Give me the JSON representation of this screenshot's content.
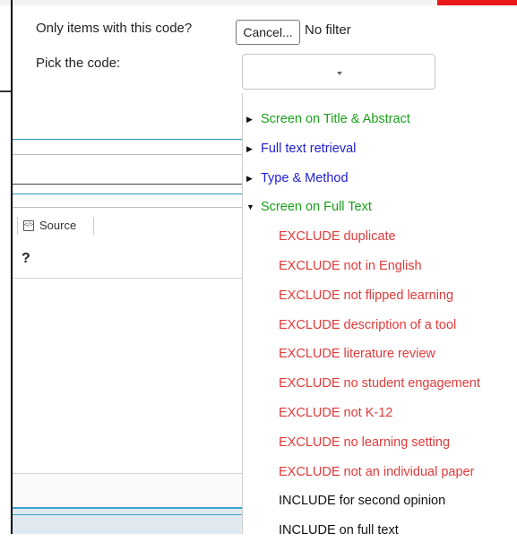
{
  "background": {
    "toolbar": {
      "source_label": "Source"
    },
    "question_mark": "?"
  },
  "popup": {
    "filter_label": "Only items with this code?",
    "cancel_button": "Cancel...",
    "filter_value": "No filter",
    "pick_label": "Pick the code:",
    "select_value": ""
  },
  "tree": [
    {
      "label": "Screen on Title & Abstract",
      "color": "#1aa01a",
      "expanded": false,
      "arrow": "▶"
    },
    {
      "label": "Full text retrieval",
      "color": "#1f1fd6",
      "expanded": false,
      "arrow": "▶"
    },
    {
      "label": "Type & Method",
      "color": "#1f1fd6",
      "expanded": false,
      "arrow": "▶"
    },
    {
      "label": "Screen on Full Text",
      "color": "#1aa01a",
      "expanded": true,
      "arrow": "▼",
      "children": [
        {
          "label": "EXCLUDE duplicate",
          "color": "#e03a3a"
        },
        {
          "label": "EXCLUDE not in English",
          "color": "#e03a3a"
        },
        {
          "label": "EXCLUDE not flipped learning",
          "color": "#e03a3a"
        },
        {
          "label": "EXCLUDE description of a tool",
          "color": "#e03a3a"
        },
        {
          "label": "EXCLUDE literature review",
          "color": "#e03a3a"
        },
        {
          "label": "EXCLUDE no student engagement",
          "color": "#e03a3a"
        },
        {
          "label": "EXCLUDE not K-12",
          "color": "#e03a3a"
        },
        {
          "label": "EXCLUDE no learning setting",
          "color": "#e03a3a"
        },
        {
          "label": "EXCLUDE not an individual paper",
          "color": "#e03a3a"
        },
        {
          "label": "INCLUDE for second opinion",
          "color": "#111111"
        },
        {
          "label": "INCLUDE on full text",
          "color": "#111111"
        }
      ]
    }
  ]
}
